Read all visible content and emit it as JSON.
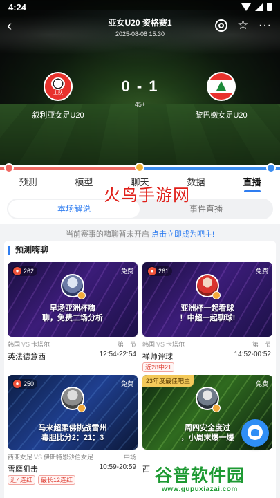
{
  "status": {
    "time": "4:24"
  },
  "header": {
    "back": "‹",
    "title": "亚女U20  资格赛1",
    "datetime": "2025-08-08 15:30",
    "star": "☆",
    "more": "···"
  },
  "match": {
    "home_team": "叙利亚女足U20",
    "home_badge_text": "主队",
    "away_team": "黎巴嫩女足U20",
    "score": "0 - 1",
    "minute": "45+"
  },
  "colors": {
    "accent": "#2f7df0",
    "home": "#f06a64",
    "away": "#3b8df0",
    "tag": "#e0453a"
  },
  "tabs": [
    {
      "label": "预测"
    },
    {
      "label": "模型"
    },
    {
      "label": "聊天"
    },
    {
      "label": "数据"
    },
    {
      "label": "直播"
    }
  ],
  "segments": {
    "active": "本场解说",
    "inactive": "事件直播"
  },
  "watermark_top": "火鸟手游网",
  "notice": {
    "text": "当前赛事的嗨聊暂未开启 ",
    "link": "点击立即成为吧主!"
  },
  "section_title": "预测嗨聊",
  "cards": [
    {
      "heat": "262",
      "price": "免费",
      "best": "",
      "caption": "早场亚洲杯嗨\n聊，免费二场分析",
      "home": "韩国",
      "vs": "VS",
      "away": "卡塔尔",
      "stage": "第一节",
      "host": "英法德意西",
      "time": "12:54-22:54",
      "tags": []
    },
    {
      "heat": "261",
      "price": "免费",
      "best": "",
      "caption": "亚洲杯一起看球\n！中超一起聊球!",
      "home": "韩国",
      "vs": "VS",
      "away": "卡塔尔",
      "stage": "第一节",
      "host": "禅师评球",
      "time": "14:52-00:52",
      "tags": [
        "近28中21"
      ]
    },
    {
      "heat": "250",
      "price": "免费",
      "best": "",
      "caption": "马来超柔佛挑战雪州\n毒胆比分2：21：3",
      "home": "西亚女足",
      "vs": "VS",
      "away": "伊斯特恩沙伯女足",
      "stage": "中场",
      "host": "雪鹰狙击",
      "time": "10:59-20:59",
      "tags": [
        "近4连红",
        "最长12连红"
      ]
    },
    {
      "heat": "",
      "price": "免费",
      "best": "23年度最佳吧主",
      "caption": "周四安全度过\n，小周末爆一爆",
      "home": "",
      "vs": "",
      "away": "",
      "stage": "",
      "host": "西",
      "time": "",
      "tags": []
    }
  ],
  "watermark_bottom": {
    "big": "谷普软件园",
    "small": "www.gupuxiazai.com"
  }
}
